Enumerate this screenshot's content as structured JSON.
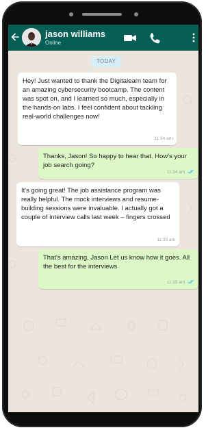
{
  "header": {
    "contact_name": "jason williams",
    "status": "Online",
    "icons": [
      "back-arrow-icon",
      "avatar",
      "video-call-icon",
      "phone-icon",
      "more-options-icon"
    ],
    "color": "#075e54"
  },
  "chat": {
    "date_label": "TODAY",
    "background": "#ece5dd",
    "messages": [
      {
        "direction": "incoming",
        "text": "Hey! Just wanted to thank the Digitalearn team for an amazing cybersecurity bootcamp. The content was spot on, and I learned so much, especially in the hands-on labs. I feel confident about tackling real-world challenges now!",
        "time": "11:34 am"
      },
      {
        "direction": "outgoing",
        "text": "Thanks, Jason! So happy to hear that. How's your job search going?",
        "time": "11:34 am",
        "status": "read"
      },
      {
        "direction": "incoming",
        "text": "It's going great! The job assistance program was really helpful. The mock interviews and resume-building sessions were invaluable. I actually got a couple of interview calls last week – fingers crossed",
        "time": "11:35 am"
      },
      {
        "direction": "outgoing",
        "text": "That's amazing, Jason Let us know how it goes. All the best for the interviews",
        "time": "11:35 am",
        "status": "read"
      }
    ]
  },
  "colors": {
    "incoming_bubble": "#ffffff",
    "outgoing_bubble": "#dcf8c6",
    "read_ticks": "#4fc3f7"
  }
}
